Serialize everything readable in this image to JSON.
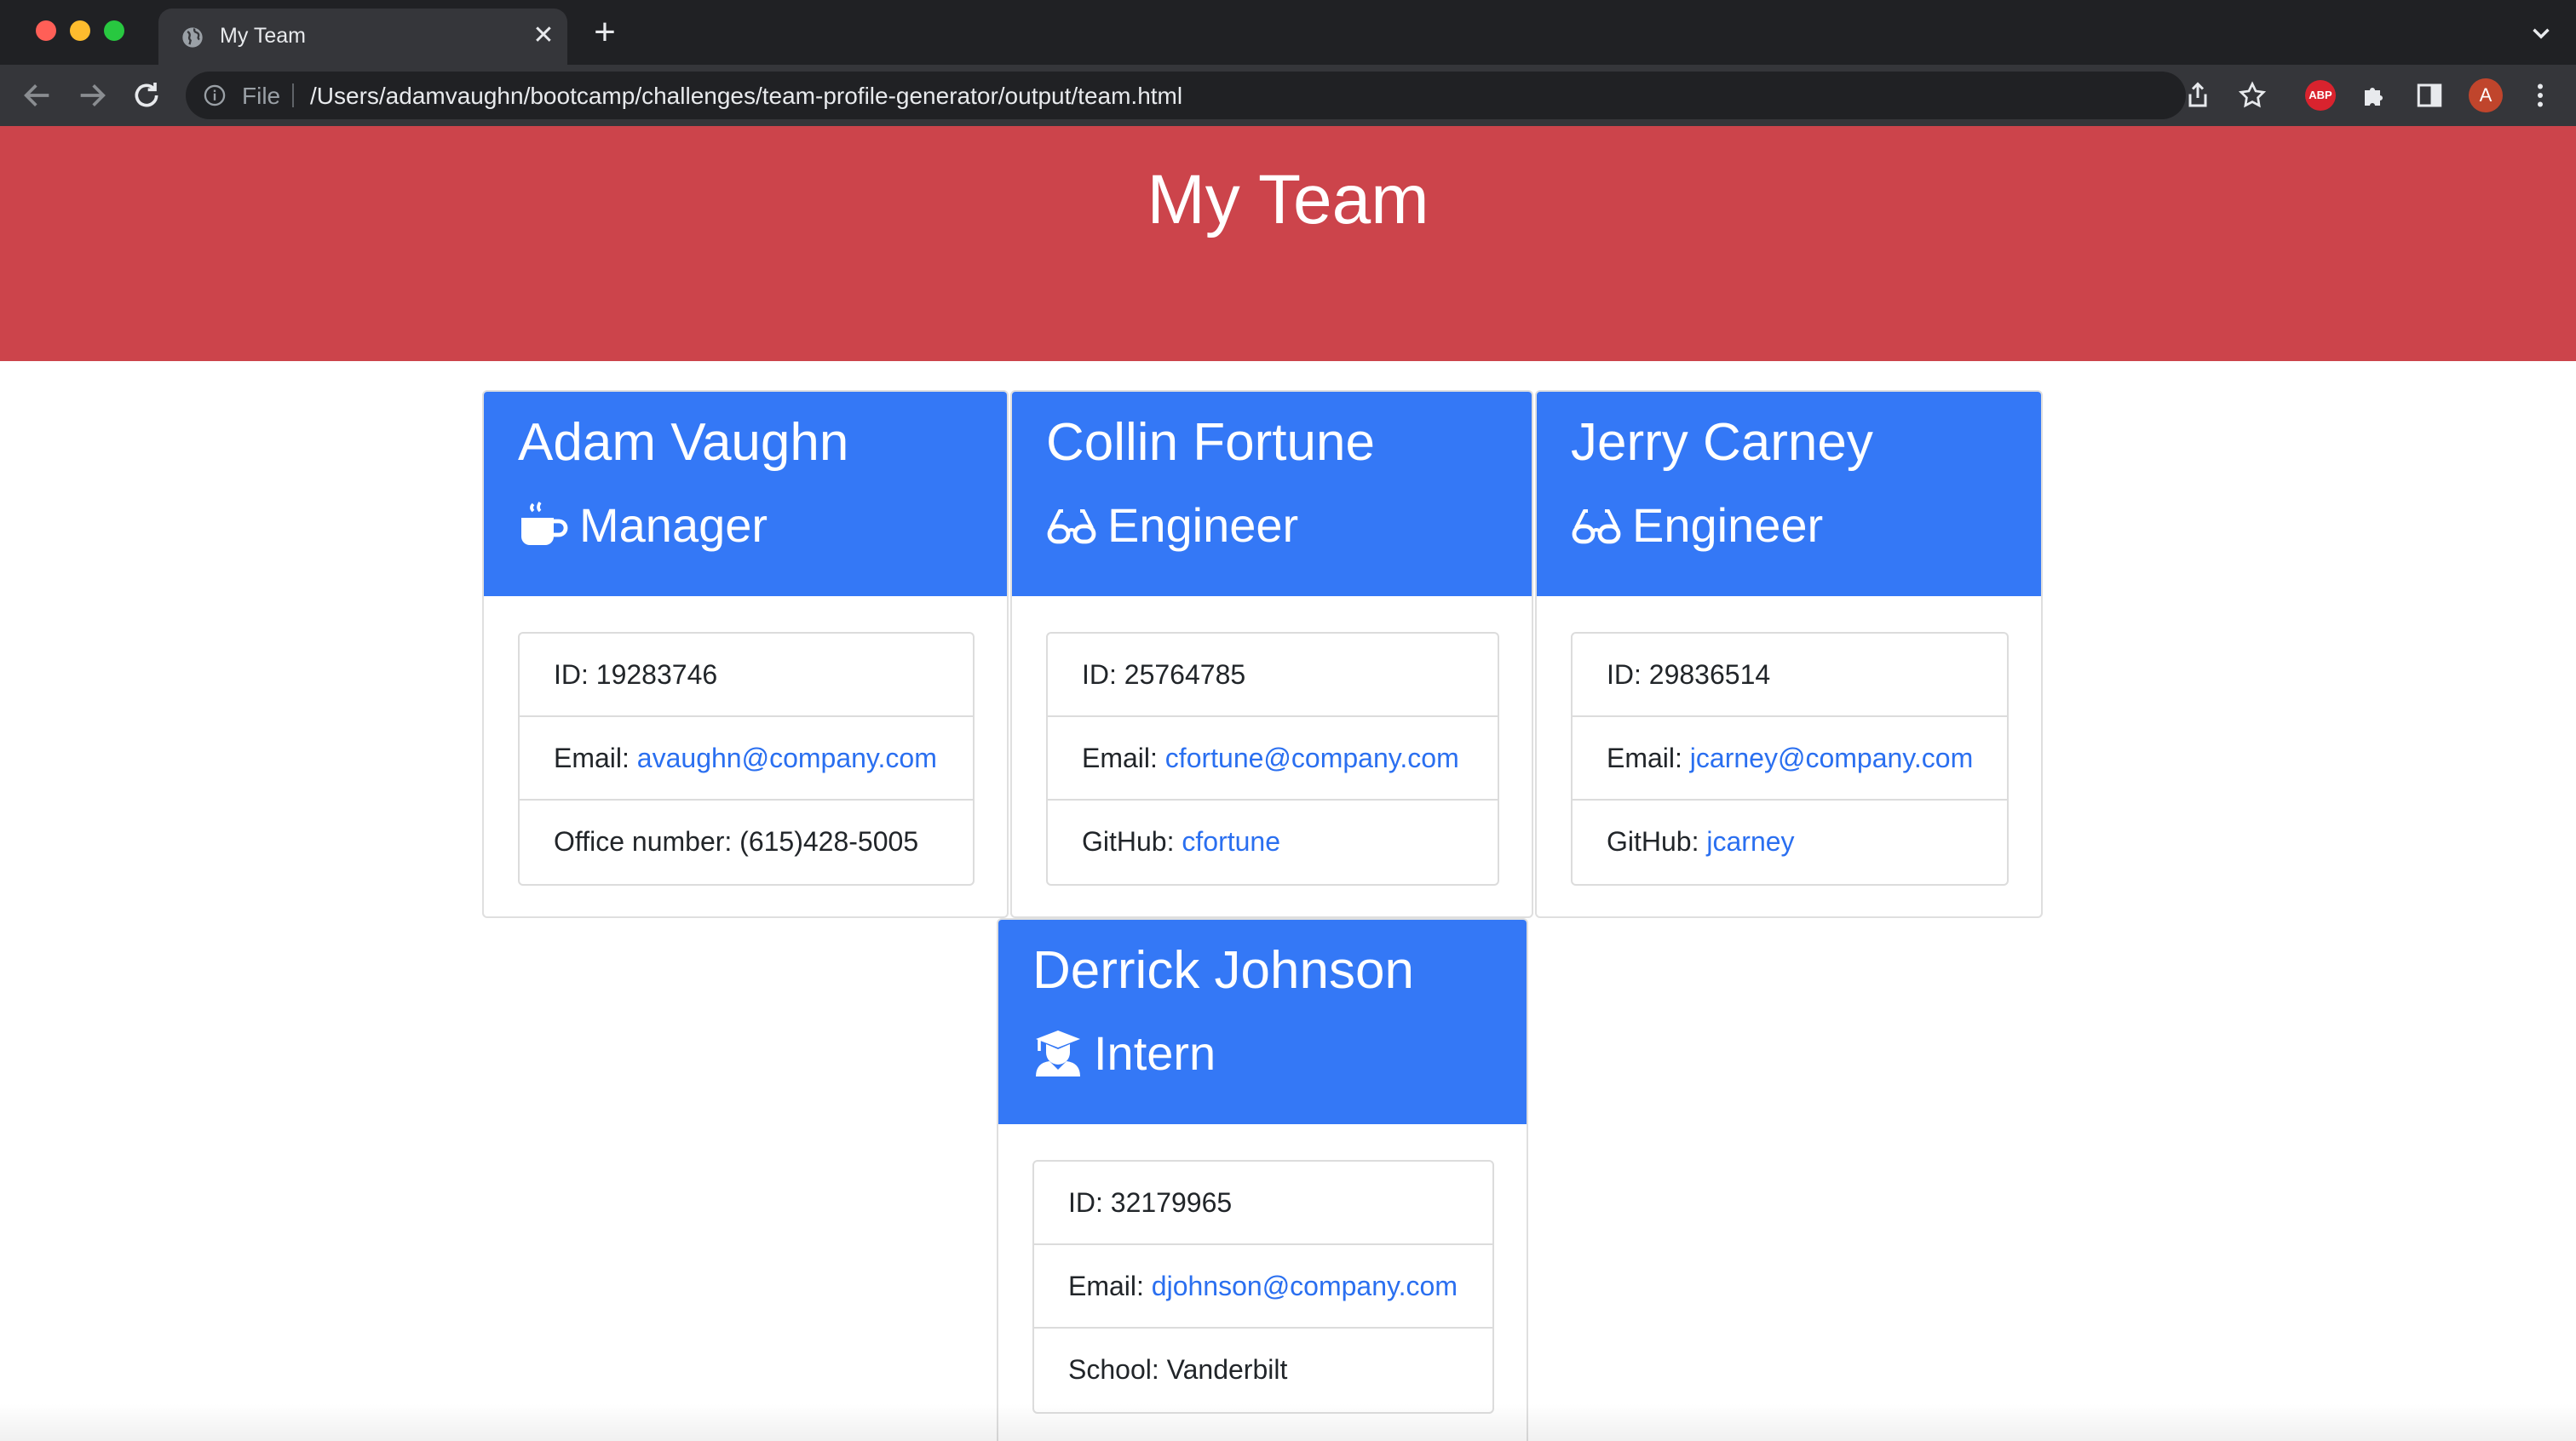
{
  "browser": {
    "tab_title": "My Team",
    "address": {
      "scheme_label": "File",
      "url": "/Users/adamvaughn/bootcamp/challenges/team-profile-generator/output/team.html"
    },
    "profile_initial": "A",
    "adblock_label": "ABP"
  },
  "page": {
    "title": "My Team",
    "colors": {
      "header": "#cc444b",
      "card_header": "#3478f6",
      "link": "#2a6ff0"
    },
    "employees": [
      {
        "name": "Adam Vaughn",
        "role": "Manager",
        "role_icon": "mug-icon",
        "id_label": "ID: 19283746",
        "email_prefix": "Email: ",
        "email": "avaughn@company.com",
        "extra_label": "Office number: ",
        "extra_value": "(615)428-5005"
      },
      {
        "name": "Collin Fortune",
        "role": "Engineer",
        "role_icon": "glasses-icon",
        "id_label": "ID: 25764785",
        "email_prefix": "Email: ",
        "email": "cfortune@company.com",
        "extra_label": "GitHub: ",
        "extra_value": "cfortune"
      },
      {
        "name": "Jerry Carney",
        "role": "Engineer",
        "role_icon": "glasses-icon",
        "id_label": "ID: 29836514",
        "email_prefix": "Email: ",
        "email": "jcarney@company.com",
        "extra_label": "GitHub: ",
        "extra_value": "jcarney"
      },
      {
        "name": "Derrick Johnson",
        "role": "Intern",
        "role_icon": "graduate-icon",
        "id_label": "ID: 32179965",
        "email_prefix": "Email: ",
        "email": "djohnson@company.com",
        "extra_label": "School: ",
        "extra_value": "Vanderbilt"
      }
    ]
  }
}
